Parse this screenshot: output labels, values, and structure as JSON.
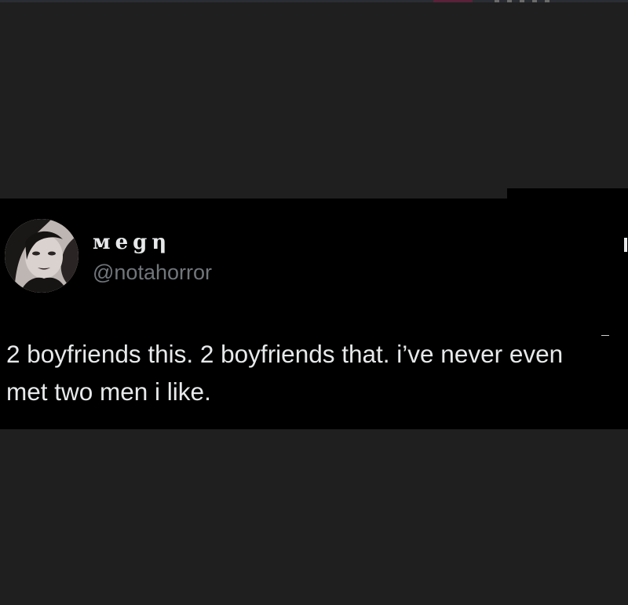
{
  "tweet": {
    "author": {
      "display_name": "мegη",
      "handle": "@notahorror",
      "avatar_icon": "profile-photo"
    },
    "text": "2 boyfriends this. 2 boyfriends that. i’ve never even met two men i like."
  },
  "colors": {
    "page_background": "#1f1f1f",
    "card_background": "#000000",
    "primary_text": "#e7e9ea",
    "secondary_text": "#71767b"
  }
}
